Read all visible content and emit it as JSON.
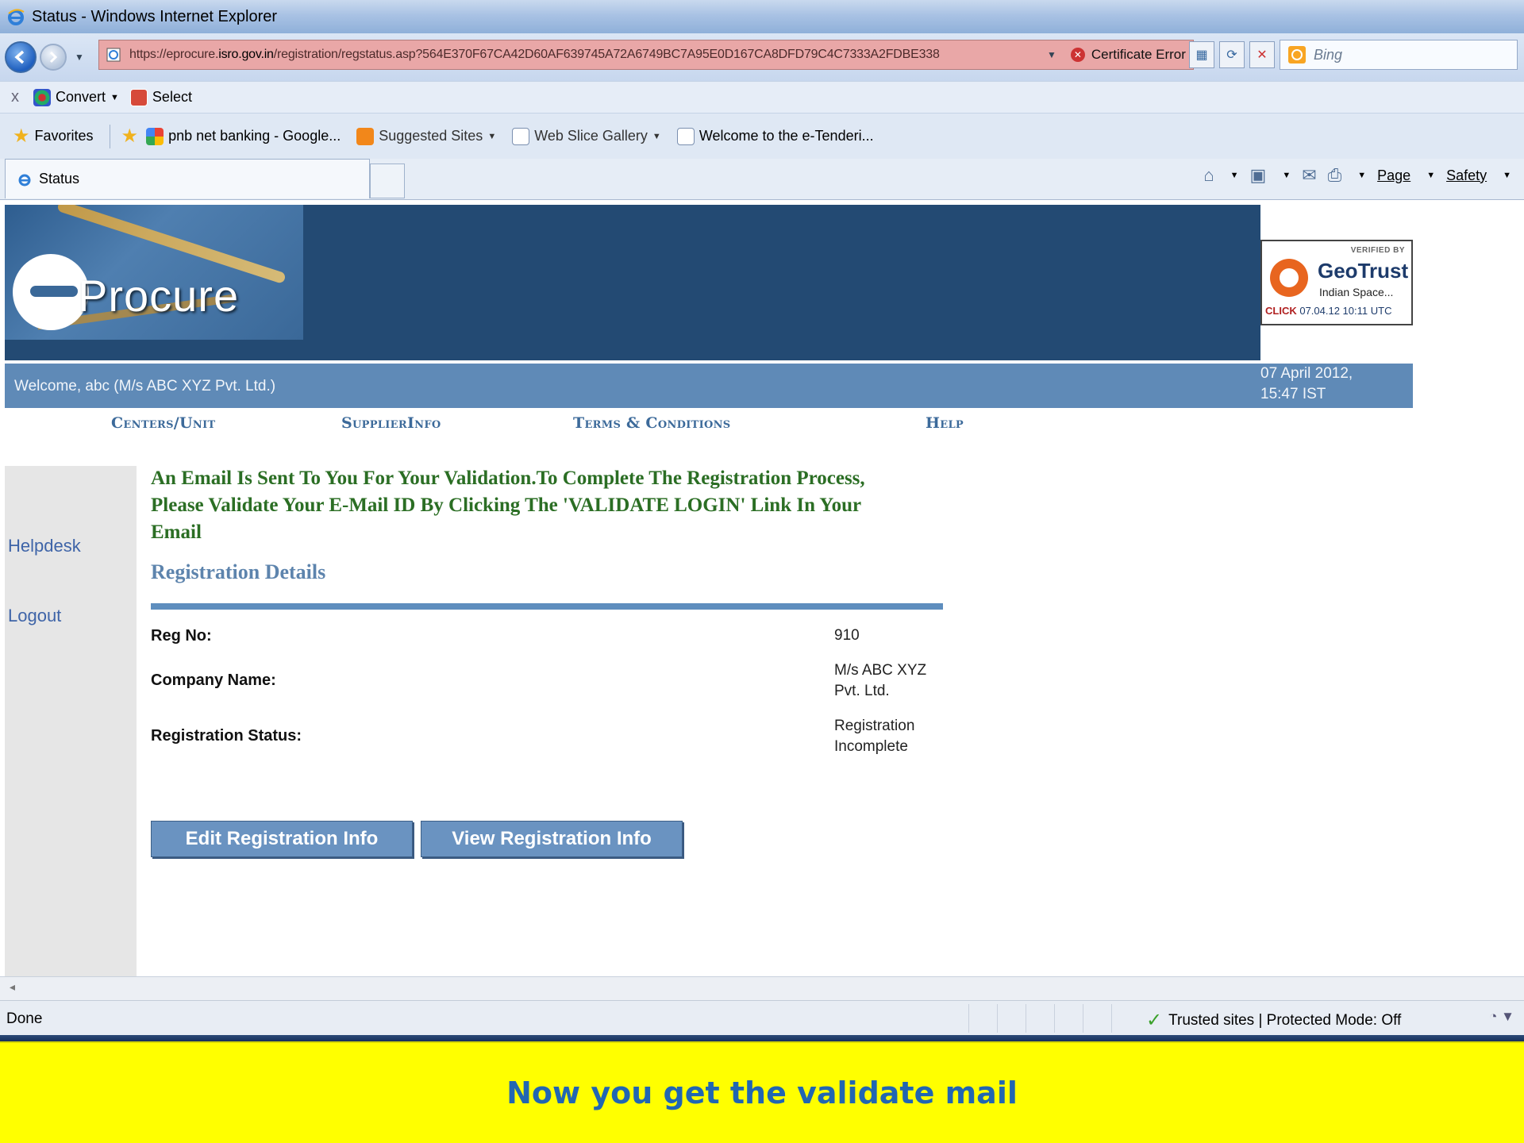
{
  "window": {
    "title": "Status - Windows Internet Explorer"
  },
  "address": {
    "url_prefix": "https://eprocure.",
    "url_domain": "isro.gov.in",
    "url_rest": "/registration/regstatus.asp?564E370F67CA42D60AF639745A72A6749BC7A95E0D167CA8DFD79C4C7333A2FDBE338",
    "cert_error": "Certificate Error",
    "search_placeholder": "Bing"
  },
  "command_row": {
    "convert": "Convert",
    "select": "Select"
  },
  "favorites_bar": {
    "favorites": "Favorites",
    "items": [
      "pnb net banking - Google...",
      "Suggested Sites",
      "Web Slice Gallery",
      "Welcome to the e-Tenderi..."
    ]
  },
  "tab": {
    "title": "Status"
  },
  "cmdbar": {
    "page": "Page",
    "safety": "Safety"
  },
  "banner": {
    "logo_text": "Procure",
    "geotrust_verified": "VERIFIED BY",
    "geotrust_brand": "GeoTrust",
    "geotrust_org": "Indian Space...",
    "geotrust_click": "CLICK",
    "geotrust_date": "07.04.12 10:11 UTC"
  },
  "welcome": {
    "text": "Welcome,  abc  (M/s ABC XYZ Pvt. Ltd.)",
    "date": "07 April 2012,",
    "time": "15:47  IST"
  },
  "menu": {
    "items": [
      "Centers/Unit",
      "SupplierInfo",
      "Terms & Conditions",
      "Help"
    ]
  },
  "sidebar": {
    "helpdesk": "Helpdesk",
    "logout": "Logout"
  },
  "main": {
    "message": "An Email Is Sent To You For Your Validation.To Complete The Registration Process, Please Validate Your E-Mail ID By Clicking The 'VALIDATE LOGIN' Link In Your Email",
    "section_title": "Registration Details",
    "fields": [
      {
        "label": "Reg No:",
        "value": "910"
      },
      {
        "label": "Company Name:",
        "value_line1": "M/s ABC XYZ",
        "value_line2": "Pvt. Ltd."
      },
      {
        "label": "Registration Status:",
        "value_line1": "Registration",
        "value_line2": "Incomplete"
      }
    ],
    "edit_button": "Edit Registration Info",
    "view_button": "View Registration Info"
  },
  "statusbar": {
    "status": "Done",
    "zone": "Trusted sites | Protected Mode: Off"
  },
  "caption": {
    "text": "Now you get the validate mail"
  }
}
